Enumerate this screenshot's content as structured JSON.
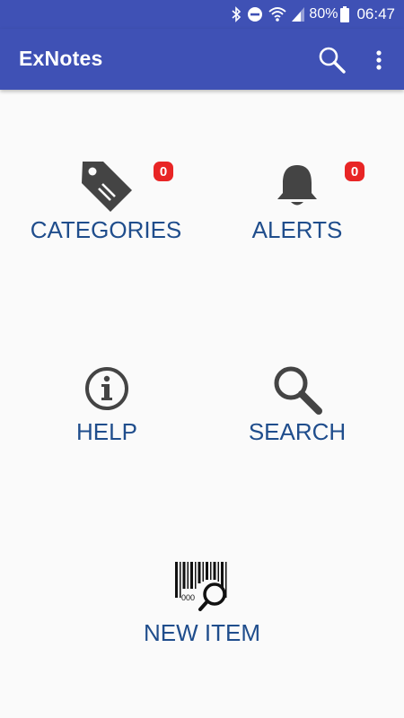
{
  "status_bar": {
    "battery": "80%",
    "time": "06:47",
    "icons": [
      "bluetooth-icon",
      "do-not-disturb-icon",
      "wifi-icon",
      "signal-icon",
      "battery-icon"
    ]
  },
  "app_bar": {
    "title": "ExNotes",
    "icons": [
      "search-icon",
      "overflow-menu-icon"
    ],
    "background": "#3f51b5"
  },
  "tiles": {
    "categories": {
      "label": "CATEGORIES",
      "badge": "0",
      "icon": "tag-icon"
    },
    "alerts": {
      "label": "ALERTS",
      "badge": "0",
      "icon": "bell-icon"
    },
    "help": {
      "label": "HELP",
      "icon": "info-icon"
    },
    "search": {
      "label": "SEARCH",
      "icon": "magnifier-icon"
    },
    "new_item": {
      "label": "NEW ITEM",
      "icon": "barcode-search-icon",
      "barcode_digits": "000"
    }
  },
  "colors": {
    "label": "#1f4d8c",
    "icon": "#444444",
    "badge": "#e82525",
    "background": "#fafafa"
  }
}
